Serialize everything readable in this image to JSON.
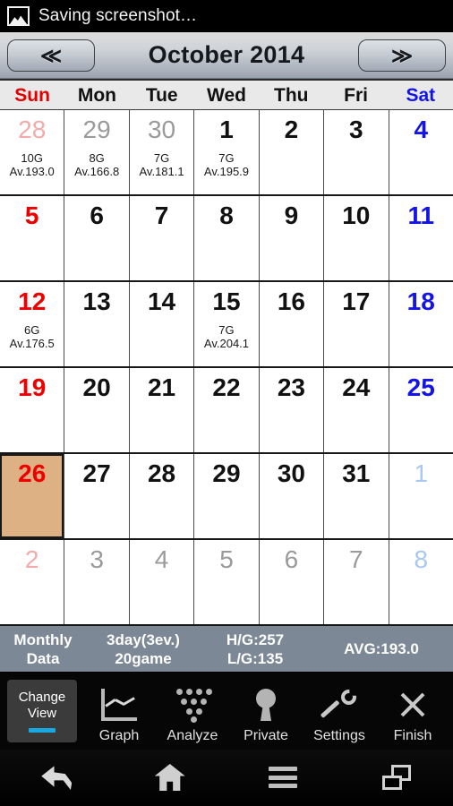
{
  "statusbar": {
    "icon": "image-icon",
    "text": "Saving screenshot…"
  },
  "header": {
    "prev_label": "≪",
    "next_label": "≫",
    "title": "October 2014"
  },
  "weekdays": [
    {
      "label": "Sun",
      "kind": "sun"
    },
    {
      "label": "Mon",
      "kind": "day"
    },
    {
      "label": "Tue",
      "kind": "day"
    },
    {
      "label": "Wed",
      "kind": "day"
    },
    {
      "label": "Thu",
      "kind": "day"
    },
    {
      "label": "Fri",
      "kind": "day"
    },
    {
      "label": "Sat",
      "kind": "sat"
    }
  ],
  "weeks": [
    [
      {
        "day": "28",
        "style": "muted-red",
        "games": "10G",
        "avg": "Av.193.0",
        "selected": false
      },
      {
        "day": "29",
        "style": "muted",
        "games": "8G",
        "avg": "Av.166.8",
        "selected": false
      },
      {
        "day": "30",
        "style": "muted",
        "games": "7G",
        "avg": "Av.181.1",
        "selected": false
      },
      {
        "day": "1",
        "style": "black",
        "games": "7G",
        "avg": "Av.195.9",
        "selected": false
      },
      {
        "day": "2",
        "style": "black",
        "games": "",
        "avg": "",
        "selected": false
      },
      {
        "day": "3",
        "style": "black",
        "games": "",
        "avg": "",
        "selected": false
      },
      {
        "day": "4",
        "style": "blue",
        "games": "",
        "avg": "",
        "selected": false
      }
    ],
    [
      {
        "day": "5",
        "style": "red",
        "games": "",
        "avg": "",
        "selected": false
      },
      {
        "day": "6",
        "style": "black",
        "games": "",
        "avg": "",
        "selected": false
      },
      {
        "day": "7",
        "style": "black",
        "games": "",
        "avg": "",
        "selected": false
      },
      {
        "day": "8",
        "style": "black",
        "games": "",
        "avg": "",
        "selected": false
      },
      {
        "day": "9",
        "style": "black",
        "games": "",
        "avg": "",
        "selected": false
      },
      {
        "day": "10",
        "style": "black",
        "games": "",
        "avg": "",
        "selected": false
      },
      {
        "day": "11",
        "style": "blue",
        "games": "",
        "avg": "",
        "selected": false
      }
    ],
    [
      {
        "day": "12",
        "style": "red",
        "games": "6G",
        "avg": "Av.176.5",
        "selected": false
      },
      {
        "day": "13",
        "style": "black",
        "games": "",
        "avg": "",
        "selected": false
      },
      {
        "day": "14",
        "style": "black",
        "games": "",
        "avg": "",
        "selected": false
      },
      {
        "day": "15",
        "style": "black",
        "games": "7G",
        "avg": "Av.204.1",
        "selected": false
      },
      {
        "day": "16",
        "style": "black",
        "games": "",
        "avg": "",
        "selected": false
      },
      {
        "day": "17",
        "style": "black",
        "games": "",
        "avg": "",
        "selected": false
      },
      {
        "day": "18",
        "style": "blue",
        "games": "",
        "avg": "",
        "selected": false
      }
    ],
    [
      {
        "day": "19",
        "style": "red",
        "games": "",
        "avg": "",
        "selected": false
      },
      {
        "day": "20",
        "style": "black",
        "games": "",
        "avg": "",
        "selected": false
      },
      {
        "day": "21",
        "style": "black",
        "games": "",
        "avg": "",
        "selected": false
      },
      {
        "day": "22",
        "style": "black",
        "games": "",
        "avg": "",
        "selected": false
      },
      {
        "day": "23",
        "style": "black",
        "games": "",
        "avg": "",
        "selected": false
      },
      {
        "day": "24",
        "style": "black",
        "games": "",
        "avg": "",
        "selected": false
      },
      {
        "day": "25",
        "style": "blue",
        "games": "",
        "avg": "",
        "selected": false
      }
    ],
    [
      {
        "day": "26",
        "style": "red",
        "games": "",
        "avg": "",
        "selected": true
      },
      {
        "day": "27",
        "style": "black",
        "games": "",
        "avg": "",
        "selected": false
      },
      {
        "day": "28",
        "style": "black",
        "games": "",
        "avg": "",
        "selected": false
      },
      {
        "day": "29",
        "style": "black",
        "games": "",
        "avg": "",
        "selected": false
      },
      {
        "day": "30",
        "style": "black",
        "games": "",
        "avg": "",
        "selected": false
      },
      {
        "day": "31",
        "style": "black",
        "games": "",
        "avg": "",
        "selected": false
      },
      {
        "day": "1",
        "style": "muted-blue",
        "games": "",
        "avg": "",
        "selected": false
      }
    ],
    [
      {
        "day": "2",
        "style": "muted-red",
        "games": "",
        "avg": "",
        "selected": false
      },
      {
        "day": "3",
        "style": "muted",
        "games": "",
        "avg": "",
        "selected": false
      },
      {
        "day": "4",
        "style": "muted",
        "games": "",
        "avg": "",
        "selected": false
      },
      {
        "day": "5",
        "style": "muted",
        "games": "",
        "avg": "",
        "selected": false
      },
      {
        "day": "6",
        "style": "muted",
        "games": "",
        "avg": "",
        "selected": false
      },
      {
        "day": "7",
        "style": "muted",
        "games": "",
        "avg": "",
        "selected": false
      },
      {
        "day": "8",
        "style": "muted-blue",
        "games": "",
        "avg": "",
        "selected": false
      }
    ]
  ],
  "monthly_data": {
    "label_line1": "Monthly",
    "label_line2": "Data",
    "days_line1": "3day(3ev.)",
    "days_line2": "20game",
    "high_line": "H/G:257",
    "low_line": "L/G:135",
    "average": "AVG:193.0"
  },
  "toolbar": {
    "change_view_line1": "Change",
    "change_view_line2": "View",
    "items": [
      {
        "label": "Graph",
        "icon": "graph-icon"
      },
      {
        "label": "Analyze",
        "icon": "bowling-pins-icon"
      },
      {
        "label": "Private",
        "icon": "keyhole-icon"
      },
      {
        "label": "Settings",
        "icon": "wrench-icon"
      },
      {
        "label": "Finish",
        "icon": "close-x-icon"
      }
    ]
  },
  "sysnav": [
    {
      "icon": "back-icon"
    },
    {
      "icon": "home-icon"
    },
    {
      "icon": "menu-icon"
    },
    {
      "icon": "recent-apps-icon"
    }
  ],
  "colors": {
    "sunday": "#e00000",
    "saturday": "#1414e6",
    "selected_cell": "#ddb184",
    "data_bar": "#7c8896",
    "accent": "#19a9e0"
  }
}
